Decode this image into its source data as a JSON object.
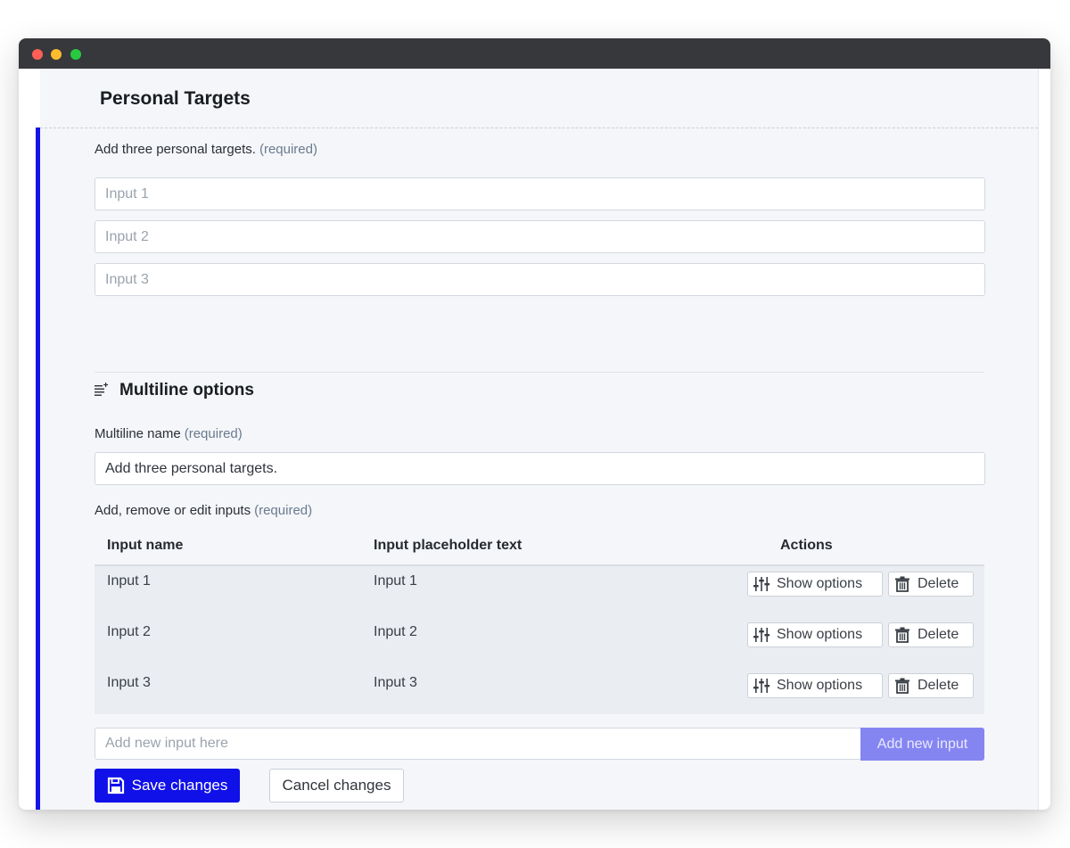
{
  "header": {
    "title": "Personal Targets"
  },
  "targets": {
    "description": "Add three personal targets.",
    "required": "(required)",
    "inputs": [
      {
        "placeholder": "Input 1",
        "value": ""
      },
      {
        "placeholder": "Input 2",
        "value": ""
      },
      {
        "placeholder": "Input 3",
        "value": ""
      }
    ]
  },
  "multiline": {
    "section_title": "Multiline options",
    "section_icon": "list-plus-icon",
    "name_label": "Multiline name",
    "name_required": "(required)",
    "name_value": "Add three personal targets.",
    "inputs_label": "Add, remove or edit inputs",
    "inputs_required": "(required)",
    "table": {
      "headers": [
        "Input name",
        "Input placeholder text",
        "Actions"
      ],
      "rows": [
        {
          "name": "Input 1",
          "placeholder": "Input 1"
        },
        {
          "name": "Input 2",
          "placeholder": "Input 2"
        },
        {
          "name": "Input 3",
          "placeholder": "Input 3"
        }
      ],
      "show_options_label": "Show options",
      "show_options_icon": "sliders-icon",
      "delete_label": "Delete",
      "delete_icon": "trash-icon"
    },
    "new_input_placeholder": "Add new input here",
    "add_button_label": "Add new input"
  },
  "footer": {
    "save_label": "Save changes",
    "save_icon": "floppy-disk-icon",
    "cancel_label": "Cancel changes"
  },
  "colors": {
    "accent": "#1414e6",
    "primary_button": "#1010e8",
    "add_button_disabled": "#8585f2",
    "titlebar": "#37383c"
  }
}
